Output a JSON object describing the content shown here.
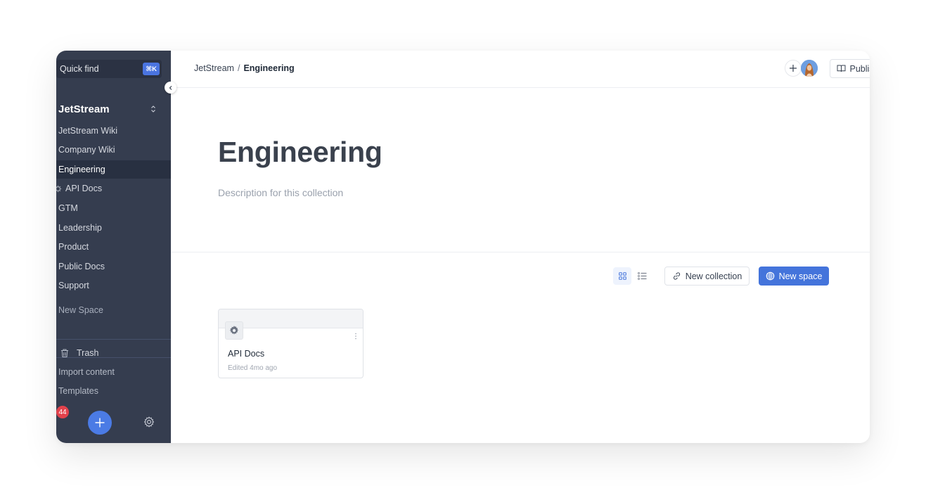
{
  "sidebar": {
    "quick_find": "Quick find",
    "shortcut": "⌘K",
    "workspace_title": "JetStream",
    "items": [
      {
        "label": "JetStream Wiki"
      },
      {
        "label": "Company Wiki"
      },
      {
        "label": "Engineering"
      },
      {
        "label": "API Docs"
      },
      {
        "label": "GTM"
      },
      {
        "label": "Leadership"
      },
      {
        "label": "Product"
      },
      {
        "label": "Public Docs"
      },
      {
        "label": "Support"
      },
      {
        "label": "New Space"
      }
    ],
    "trash": "Trash",
    "import_content": "Import content",
    "templates": "Templates",
    "badge_count": "44"
  },
  "header": {
    "breadcrumb_root": "JetStream",
    "breadcrumb_sep": "/",
    "breadcrumb_current": "Engineering",
    "publish_label": "Publish"
  },
  "main": {
    "title": "Engineering",
    "description": "Description for this collection",
    "new_collection_label": "New collection",
    "new_space_label": "New space",
    "card": {
      "title": "API Docs",
      "subtitle": "Edited 4mo ago"
    }
  },
  "colors": {
    "sidebar_bg": "#353d4f",
    "accent": "#4474db",
    "badge": "#e2424c"
  },
  "icons": [
    "search-shortcut",
    "chevron-left-icon",
    "chevron-updown-icon",
    "gear-icon",
    "trash-icon",
    "plus-icon",
    "settings-icon",
    "book-icon",
    "more-vertical-icon",
    "grid-view-icon",
    "list-view-icon",
    "link-icon",
    "globe-icon"
  ]
}
